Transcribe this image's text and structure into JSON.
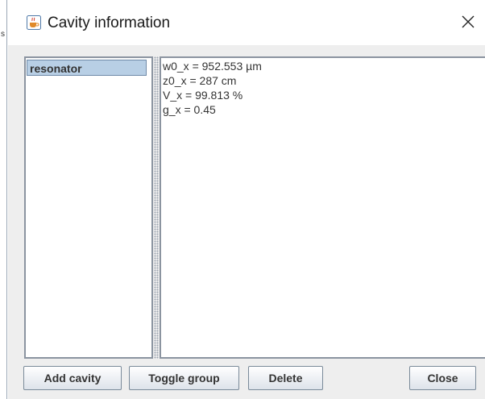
{
  "window": {
    "title": "Cavity information",
    "icon": "java-cup-icon",
    "close_icon": "close-icon"
  },
  "list": {
    "items": [
      {
        "label": "resonator",
        "selected": true
      }
    ]
  },
  "details": {
    "lines": [
      "w0_x = 952.553 µm",
      "z0_x = 287 cm",
      "V_x = 99.813 %",
      "g_x = 0.45"
    ]
  },
  "buttons": {
    "add_cavity": "Add cavity",
    "toggle_group": "Toggle group",
    "delete": "Delete",
    "close": "Close"
  },
  "colors": {
    "selection": "#b8cfe5",
    "panel_border": "#8b94a0",
    "dialog_bg": "#eeeeee"
  }
}
